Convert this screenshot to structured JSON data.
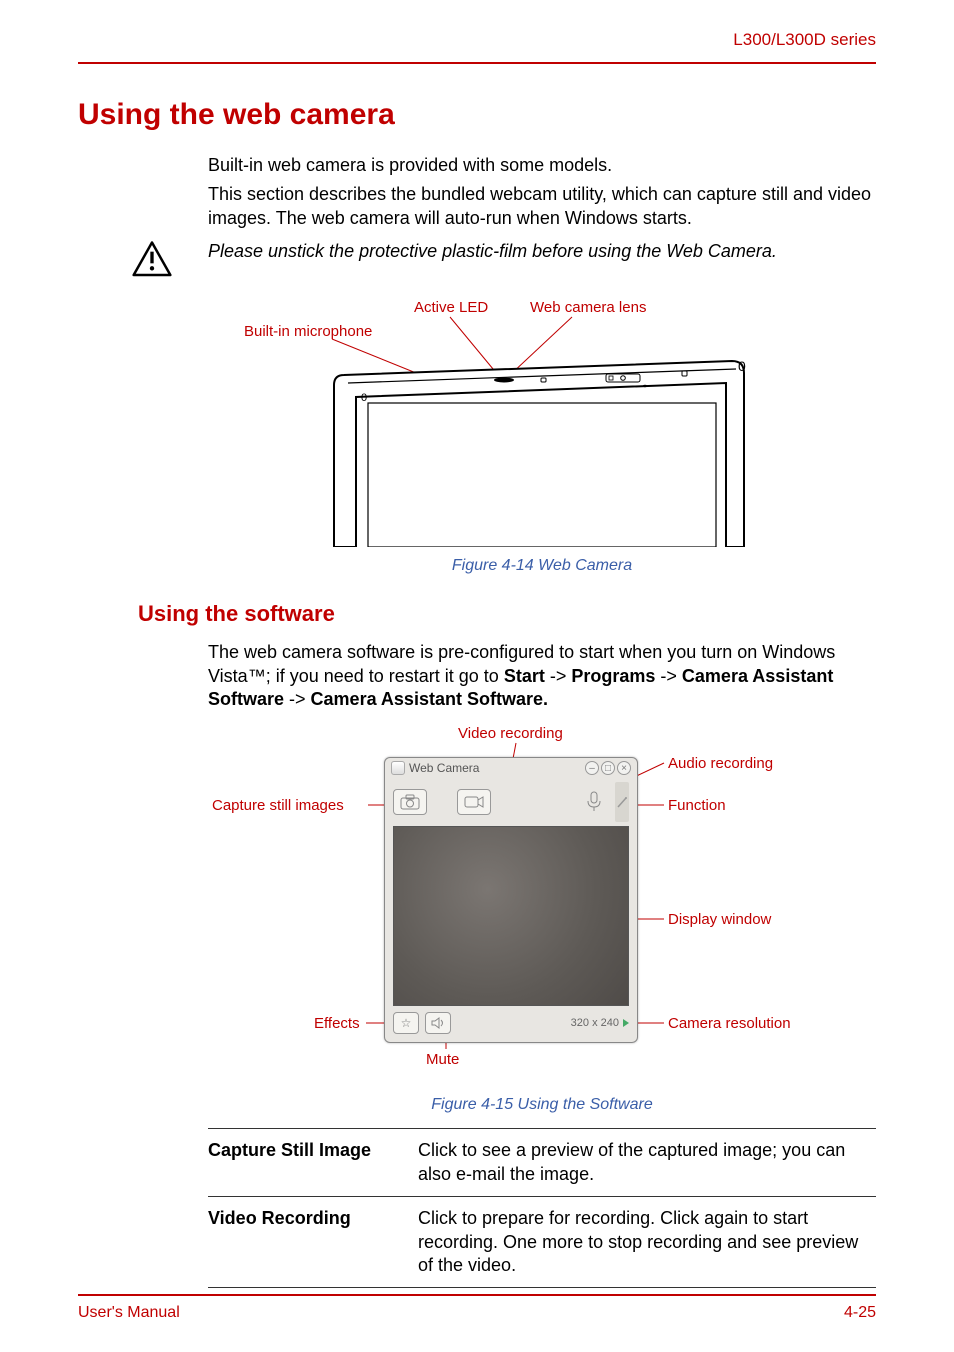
{
  "header": {
    "series": "L300/L300D series"
  },
  "h1": "Using the web camera",
  "intro1": "Built-in web camera is provided with some models.",
  "intro2": "This section describes the bundled webcam utility, which can capture still and video images. The web camera will auto-run when Windows starts.",
  "note": "Please unstick the protective plastic-film before using the Web Camera.",
  "fig1": {
    "callouts": {
      "mic": "Built-in microphone",
      "led": "Active LED",
      "lens": "Web camera lens"
    },
    "caption": "Figure 4-14 Web Camera"
  },
  "h2": "Using the software",
  "software_para_pre": "The web camera software is pre-configured to start when you turn on Windows Vista™; if you need to restart it go to ",
  "software_path": {
    "start": "Start",
    "arrow": " -> ",
    "programs": "Programs",
    "cas1": "Camera Assistant Software",
    "cas2": "Camera Assistant Software."
  },
  "fig2": {
    "callouts": {
      "video_rec": "Video recording",
      "audio_rec": "Audio recording",
      "capture": "Capture still images",
      "function": "Function",
      "display": "Display window",
      "resolution": "Camera resolution",
      "effects": "Effects",
      "mute": "Mute"
    },
    "window_title": "Web Camera",
    "resolution_text": "320 x 240",
    "caption": "Figure 4-15 Using the Software"
  },
  "table": [
    {
      "term": "Capture Still Image",
      "desc": "Click to see a preview of the captured image; you can also e-mail the image."
    },
    {
      "term": "Video Recording",
      "desc": "Click to prepare for recording. Click again to start recording. One more to stop recording and see preview of the video."
    }
  ],
  "footer": {
    "left": "User's Manual",
    "right": "4-25"
  }
}
